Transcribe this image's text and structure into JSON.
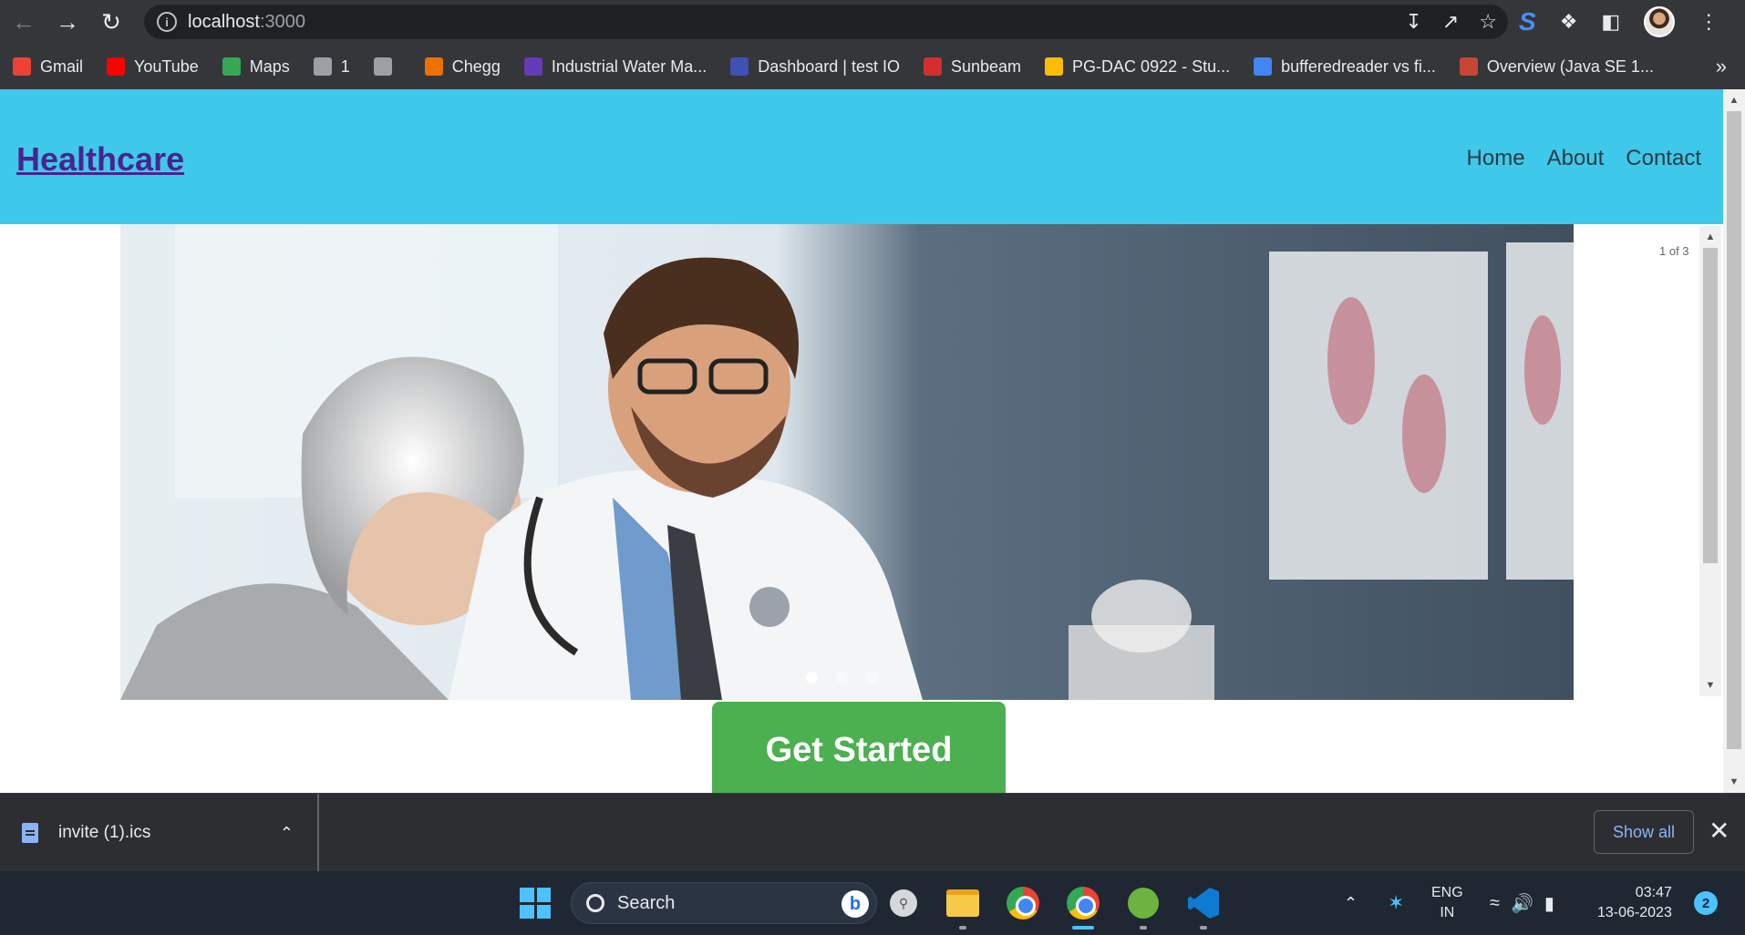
{
  "browser": {
    "url_host": "localhost",
    "url_port": ":3000",
    "nav_icons": [
      "back-icon",
      "forward-icon",
      "reload-icon"
    ],
    "toolbar_icons": [
      "install-icon",
      "share-icon",
      "bookmark-star-icon",
      "extension-s-icon",
      "extensions-puzzle-icon",
      "side-panel-icon",
      "profile-avatar",
      "menu-icon"
    ],
    "bookmarks": [
      {
        "label": "Gmail",
        "icon": "gmail-icon",
        "color": "#ea4335"
      },
      {
        "label": "YouTube",
        "icon": "youtube-icon",
        "color": "#ff0000"
      },
      {
        "label": "Maps",
        "icon": "maps-icon",
        "color": "#34a853"
      },
      {
        "label": "1",
        "icon": "globe-icon",
        "color": "#9aa0a6"
      },
      {
        "label": "",
        "icon": "download-icon",
        "color": "#9aa0a6"
      },
      {
        "label": "Chegg",
        "icon": "chegg-icon",
        "color": "#eb7100"
      },
      {
        "label": "Industrial Water Ma...",
        "icon": "forms-icon",
        "color": "#673ab7"
      },
      {
        "label": "Dashboard | test IO",
        "icon": "testio-icon",
        "color": "#3f51b5"
      },
      {
        "label": "Sunbeam",
        "icon": "sunbeam-icon",
        "color": "#d32f2f"
      },
      {
        "label": "PG-DAC 0922 - Stu...",
        "icon": "drive-icon",
        "color": "#fbbc04"
      },
      {
        "label": "bufferedreader vs fi...",
        "icon": "google-icon",
        "color": "#4285f4"
      },
      {
        "label": "Overview (Java SE 1...",
        "icon": "oracle-icon",
        "color": "#c74634"
      }
    ],
    "more_label": "»"
  },
  "site": {
    "brand": "Healthcare",
    "nav": [
      "Home",
      "About",
      "Contact"
    ],
    "header_color": "#3ec9ea",
    "carousel": {
      "counter": "1 of 3",
      "slides": 3,
      "active_slide": 1
    },
    "cta_label": "Get Started",
    "cta_color": "#4caf50"
  },
  "downloads": {
    "file_name": "invite (1).ics",
    "show_all_label": "Show all",
    "close_label": "✕"
  },
  "taskbar": {
    "search_placeholder": "Search",
    "language": "ENG",
    "region": "IN",
    "time": "03:47",
    "date": "13-06-2023",
    "notification_count": "2",
    "apps": [
      "windows-start",
      "search-app",
      "file-explorer",
      "chrome",
      "chrome-profile",
      "spring-tools",
      "vscode"
    ]
  }
}
